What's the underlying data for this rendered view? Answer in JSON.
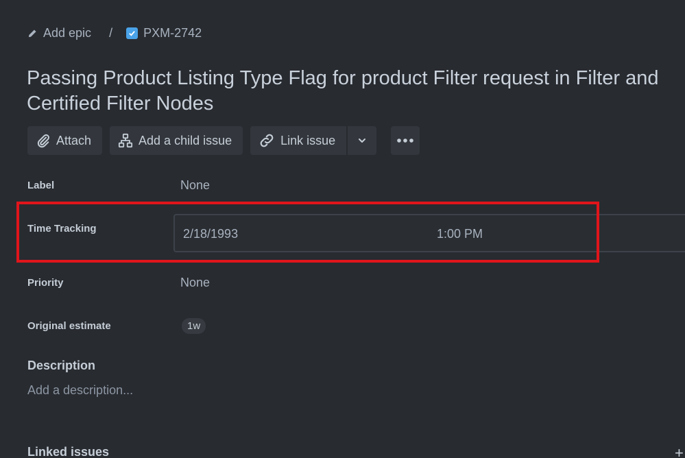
{
  "breadcrumb": {
    "epic_label": "Add epic",
    "separator": "/",
    "issue_key": "PXM-2742"
  },
  "issue": {
    "title_line1": "Passing Product Listing Type Flag for product Filter request in Filter and",
    "title_line2": "Certified Filter Nodes"
  },
  "toolbar": {
    "attach": "Attach",
    "add_child": "Add a child issue",
    "link_issue": "Link issue"
  },
  "fields": {
    "label": {
      "name": "Label",
      "value": "None"
    },
    "time_tracking": {
      "name": "Time Tracking",
      "date": "2/18/1993",
      "time": "1:00 PM"
    },
    "priority": {
      "name": "Priority",
      "value": "None"
    },
    "original_estimate": {
      "name": "Original estimate",
      "value": "1w"
    }
  },
  "description": {
    "heading": "Description",
    "placeholder": "Add a description..."
  },
  "linked_issues": {
    "heading": "Linked issues",
    "add": "+"
  },
  "colors": {
    "background": "#282b30",
    "button": "#33373d",
    "checkbox": "#4aa3e8",
    "highlight": "#e0151b"
  }
}
